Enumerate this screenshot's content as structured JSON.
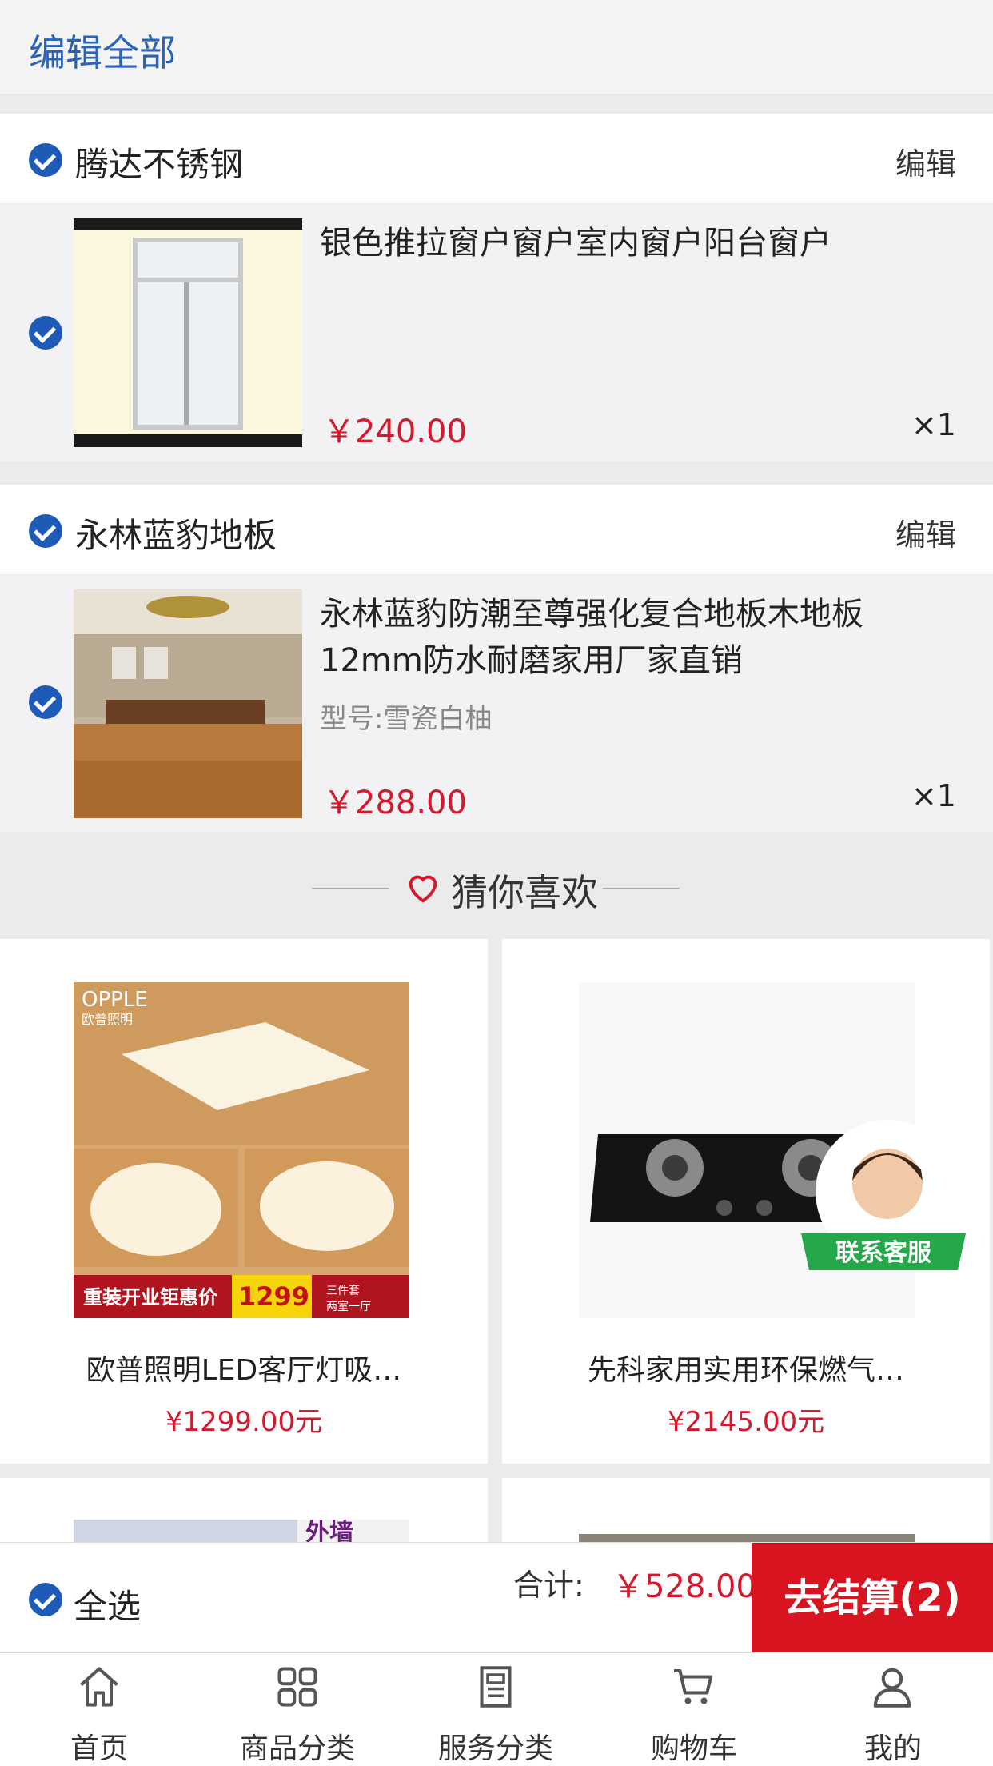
{
  "header": {
    "edit_all_label": "编辑全部"
  },
  "stores": [
    {
      "name": "腾达不锈钢",
      "edit_label": "编辑",
      "item": {
        "title": "银色推拉窗户窗户室内窗户阳台窗户",
        "spec": "",
        "price": "￥240.00",
        "qty": "×1"
      }
    },
    {
      "name": "永林蓝豹地板",
      "edit_label": "编辑",
      "item": {
        "title": "永林蓝豹防潮至尊强化复合地板木地板12mm防水耐磨家用厂家直销",
        "spec": "型号:雪瓷白柚",
        "price": "￥288.00",
        "qty": "×1"
      }
    }
  ],
  "guess": {
    "title": "猜你喜欢",
    "products": [
      {
        "name": "欧普照明LED客厅灯吸…",
        "price": "¥1299.00元",
        "logo": "OPPLE",
        "logo_sub": "欧普照明",
        "promo_text": "重装开业钜惠价",
        "promo_price": "1299",
        "promo_tag_1": "三件套",
        "promo_tag_2": "两室一厅"
      },
      {
        "name": "先科家用实用环保燃气…",
        "price": "¥2145.00元"
      }
    ],
    "partial_banner_text": "外墙"
  },
  "service_badge": "联系客服",
  "cart_bar": {
    "select_all_label": "全选",
    "total_label": "合计:",
    "total_value": "￥528.00",
    "checkout_label": "去结算(2)"
  },
  "tabs": [
    {
      "label": "首页",
      "icon": "home-icon"
    },
    {
      "label": "商品分类",
      "icon": "grid-icon"
    },
    {
      "label": "服务分类",
      "icon": "document-icon"
    },
    {
      "label": "购物车",
      "icon": "cart-icon"
    },
    {
      "label": "我的",
      "icon": "user-icon"
    }
  ],
  "colors": {
    "accent": "#1d5bb7",
    "price": "#d6182c",
    "checkout": "#d7141f"
  }
}
